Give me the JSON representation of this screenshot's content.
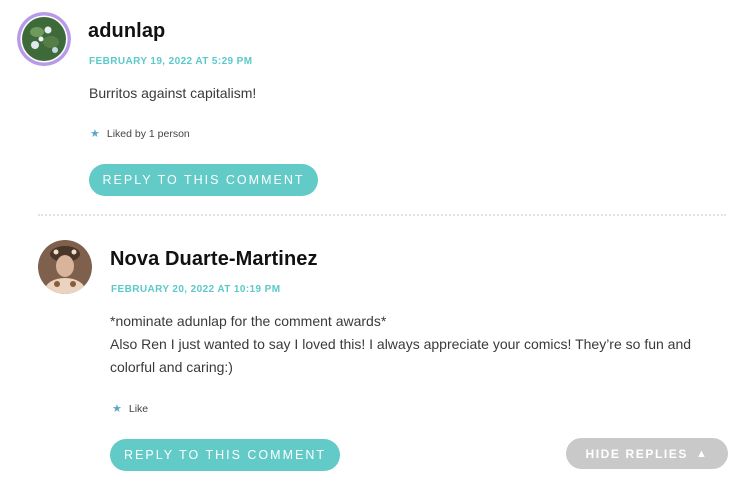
{
  "comments": [
    {
      "author": "adunlap",
      "date": "FEBRUARY 19, 2022 AT 5:29 PM",
      "lines": [
        "Burritos against capitalism!"
      ],
      "likes": "Liked by 1 person",
      "reply_label": "REPLY TO THIS COMMENT",
      "avatar_icon": "flowers-photo",
      "avatar_border": "#b79be8"
    },
    {
      "author": "Nova Duarte-Martinez",
      "date": "FEBRUARY 20, 2022 AT 10:19 PM",
      "lines": [
        "*nominate adunlap for the comment awards*",
        "Also Ren I just wanted to say I loved this! I always appreciate your comics! They’re so fun and",
        "colorful and caring:)"
      ],
      "likes": "Like",
      "reply_label": "REPLY TO THIS COMMENT",
      "avatar_icon": "person-photo"
    }
  ],
  "hide_replies": {
    "label": "HIDE REPLIES",
    "icon": "triangle-up-icon"
  },
  "colors": {
    "accent": "#5bc9c9",
    "button": "#62cbc7",
    "hide_button": "#c9c9c9",
    "star": "#5aa8c8"
  }
}
